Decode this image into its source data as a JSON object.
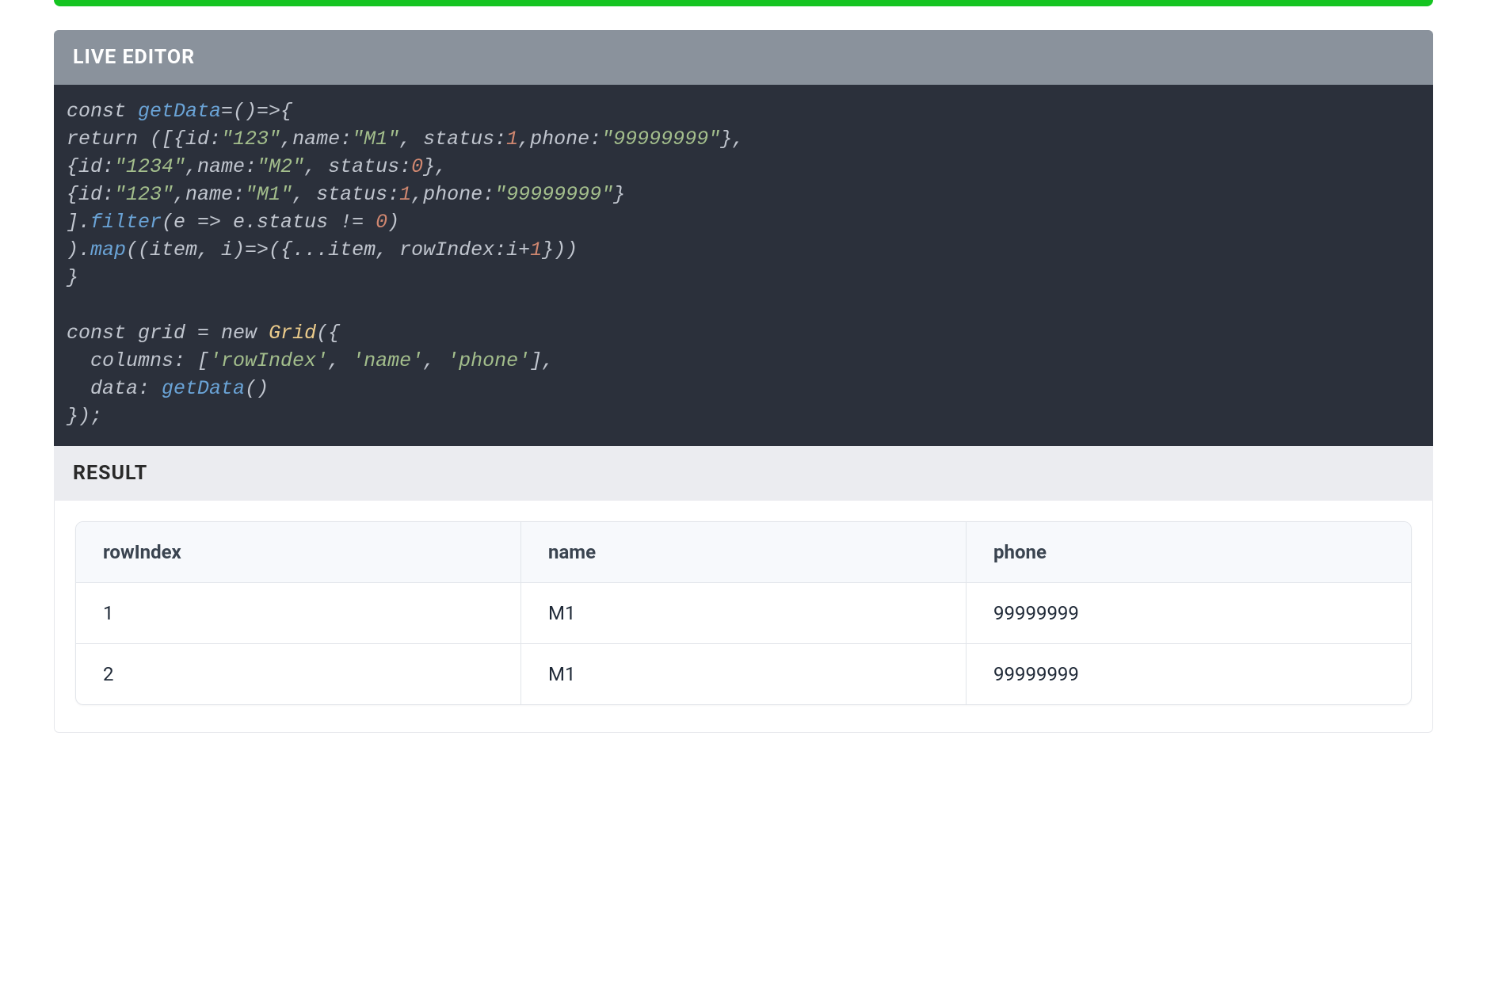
{
  "top_bar_color": "#15c421",
  "live_editor": {
    "title": "LIVE EDITOR",
    "code": {
      "l1_const": "const ",
      "l1_fn": "getData",
      "l1_rest": "=()=>{",
      "l2_return": "return ",
      "l2_a": "([{id:",
      "l2_s1": "\"123\"",
      "l2_b": ",name:",
      "l2_s2": "\"M1\"",
      "l2_c": ", status:",
      "l2_n1": "1",
      "l2_d": ",phone:",
      "l2_s3": "\"99999999\"",
      "l2_e": "},",
      "l3_a": "{id:",
      "l3_s1": "\"1234\"",
      "l3_b": ",name:",
      "l3_s2": "\"M2\"",
      "l3_c": ", status:",
      "l3_n1": "0",
      "l3_d": "},",
      "l4_a": "{id:",
      "l4_s1": "\"123\"",
      "l4_b": ",name:",
      "l4_s2": "\"M1\"",
      "l4_c": ", status:",
      "l4_n1": "1",
      "l4_d": ",phone:",
      "l4_s3": "\"99999999\"",
      "l4_e": "}",
      "l5_a": "].",
      "l5_fn": "filter",
      "l5_b": "(e => e.status != ",
      "l5_n": "0",
      "l5_c": ")",
      "l6_a": ").",
      "l6_fn": "map",
      "l6_b": "((item, i)=>({...item, rowIndex:i+",
      "l6_n": "1",
      "l6_c": "}))",
      "l7": "}",
      "blank": "",
      "l9_const": "const ",
      "l9_var": "grid = ",
      "l9_new": "new ",
      "l9_class": "Grid",
      "l9_open": "({",
      "l10_a": "  columns: [",
      "l10_s1": "'rowIndex'",
      "l10_b": ", ",
      "l10_s2": "'name'",
      "l10_c": ", ",
      "l10_s3": "'phone'",
      "l10_d": "],",
      "l11_a": "  data: ",
      "l11_fn": "getData",
      "l11_b": "()",
      "l12": "});"
    }
  },
  "result": {
    "title": "RESULT",
    "columns": [
      "rowIndex",
      "name",
      "phone"
    ],
    "rows": [
      {
        "rowIndex": "1",
        "name": "M1",
        "phone": "99999999"
      },
      {
        "rowIndex": "2",
        "name": "M1",
        "phone": "99999999"
      }
    ]
  }
}
